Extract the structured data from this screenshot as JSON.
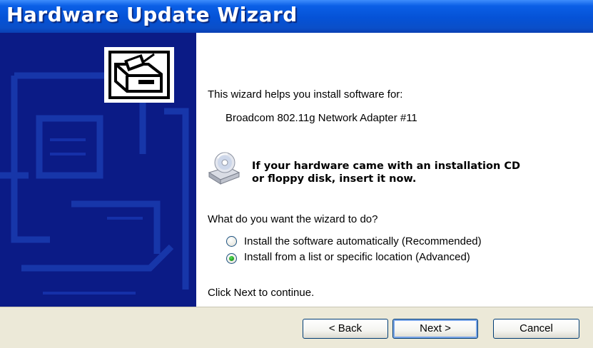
{
  "window": {
    "title": "Hardware Update Wizard"
  },
  "content": {
    "intro": "This wizard helps you install software for:",
    "device_name": "Broadcom 802.11g Network Adapter #11",
    "cd_message_line1": "If your hardware came with an installation CD",
    "cd_message_line2": "or floppy disk, insert it now.",
    "question": "What do you want the wizard to do?",
    "options": [
      {
        "label": "Install the software automatically (Recommended)",
        "selected": false
      },
      {
        "label": "Install from a list or specific location (Advanced)",
        "selected": true
      }
    ],
    "footer_note": "Click Next to continue."
  },
  "buttons": {
    "back": "< Back",
    "next": "Next >",
    "cancel": "Cancel"
  },
  "icons": {
    "wizard": "hardware-install-icon",
    "cd": "cd-drive-icon"
  },
  "colors": {
    "title_bar": "#0552d6",
    "side_panel": "#0b1b86",
    "button_bar": "#ece9d8",
    "radio_selected": "#21a121"
  }
}
